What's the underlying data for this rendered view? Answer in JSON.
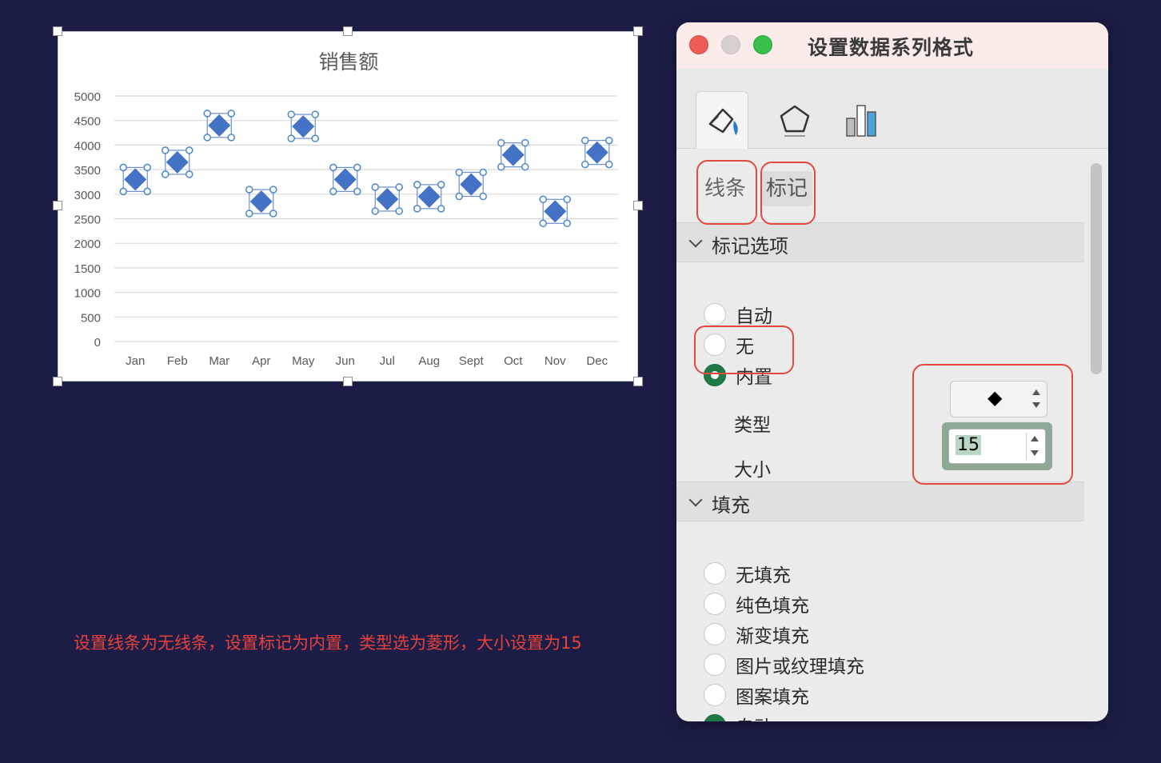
{
  "chart_data": {
    "type": "scatter",
    "title": "销售额",
    "categories": [
      "Jan",
      "Feb",
      "Mar",
      "Apr",
      "May",
      "Jun",
      "Jul",
      "Aug",
      "Sept",
      "Oct",
      "Nov",
      "Dec"
    ],
    "values": [
      3300,
      3650,
      4400,
      2850,
      4380,
      3300,
      2900,
      2950,
      3200,
      3800,
      2650,
      3850
    ],
    "yticks": [
      "5000",
      "4500",
      "4000",
      "3500",
      "3000",
      "2500",
      "2000",
      "1500",
      "1000",
      "500",
      "0"
    ],
    "ylim": [
      0,
      5000
    ],
    "grid": true,
    "marker": "diamond",
    "marker_color": "#4472c4"
  },
  "instruction": "设置线条为无线条，设置标记为内置，类型选为菱形，大小设置为15",
  "panel": {
    "title": "设置数据系列格式",
    "tabs": [
      "fill-line-icon",
      "effects-icon",
      "series-options-icon"
    ],
    "subtabs": {
      "line": "线条",
      "marker": "标记"
    },
    "marker_options": {
      "header": "标记选项",
      "options": [
        {
          "label": "自动",
          "selected": false
        },
        {
          "label": "无",
          "selected": false
        },
        {
          "label": "内置",
          "selected": true
        }
      ],
      "type_label": "类型",
      "type_value": "◆",
      "size_label": "大小",
      "size_value": "15"
    },
    "fill": {
      "header": "填充",
      "options": [
        {
          "label": "无填充",
          "selected": false
        },
        {
          "label": "纯色填充",
          "selected": false
        },
        {
          "label": "渐变填充",
          "selected": false
        },
        {
          "label": "图片或纹理填充",
          "selected": false
        },
        {
          "label": "图案填充",
          "selected": false
        },
        {
          "label": "自动",
          "selected": true
        }
      ]
    }
  },
  "colors": {
    "background": "#1b1d46",
    "annotation": "#e24a3f",
    "accent_green": "#1f7a46"
  }
}
